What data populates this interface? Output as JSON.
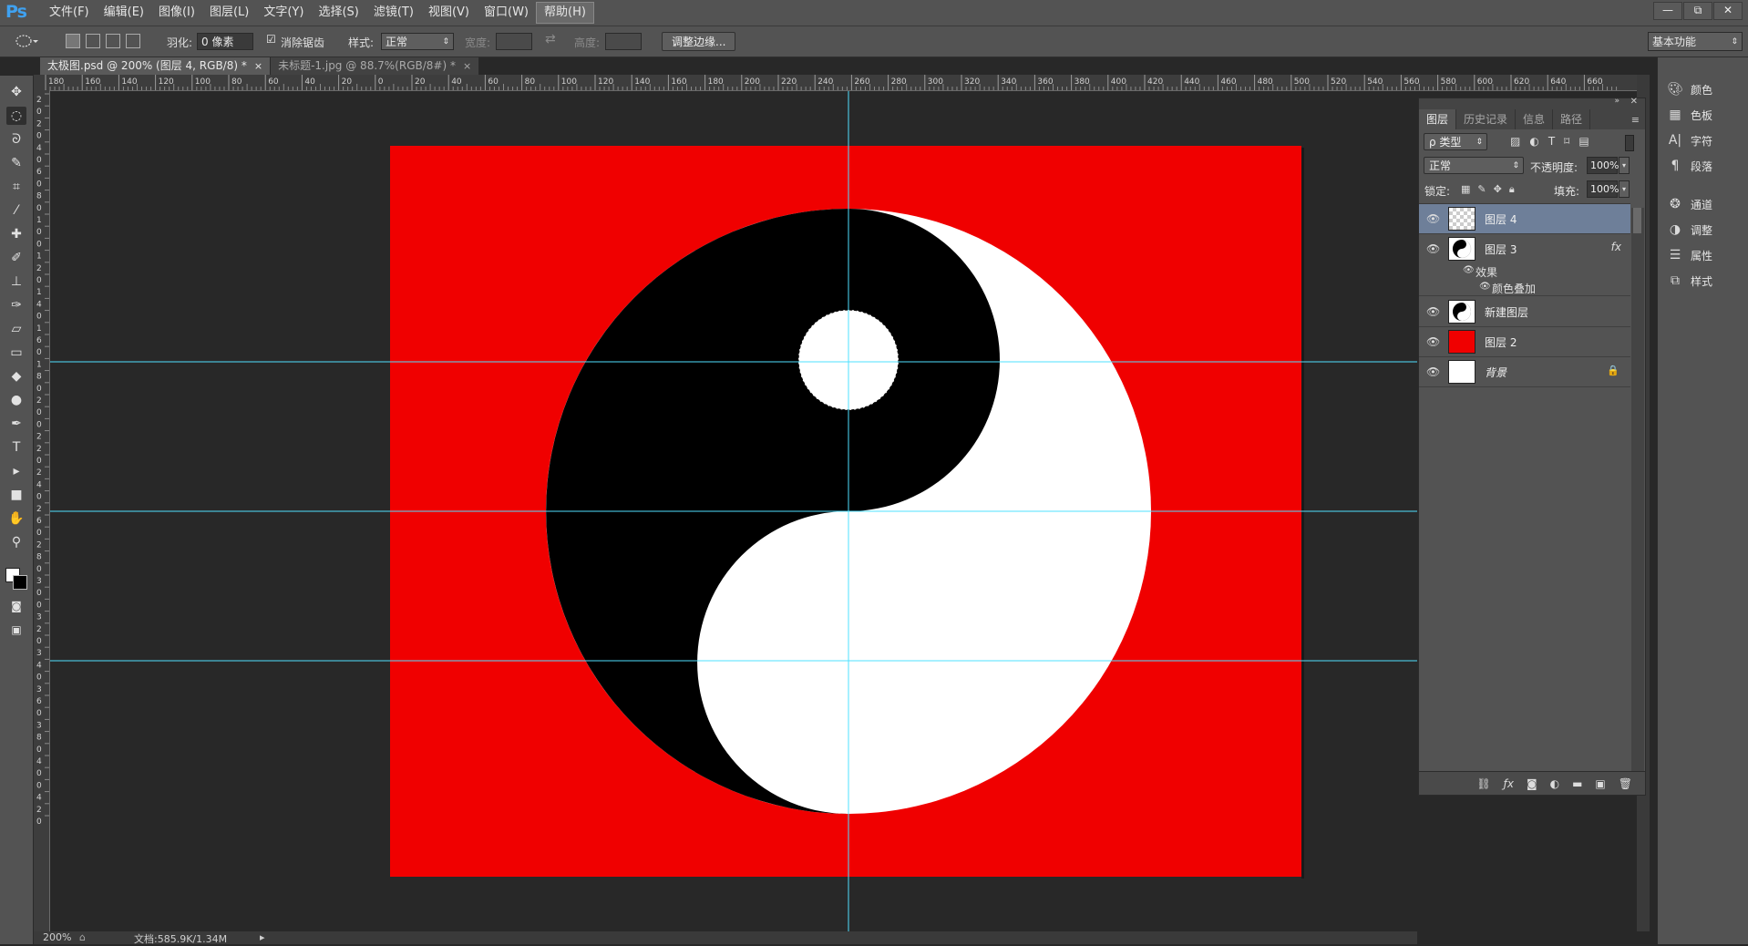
{
  "app": {
    "logo": "Ps",
    "menu": [
      "文件(F)",
      "编辑(E)",
      "图像(I)",
      "图层(L)",
      "文字(Y)",
      "选择(S)",
      "滤镜(T)",
      "视图(V)",
      "窗口(W)",
      "帮助(H)"
    ],
    "window_controls": [
      "—",
      "⧉",
      "✕"
    ]
  },
  "options": {
    "feather_label": "羽化:",
    "feather_value": "0 像素",
    "antialias_label": "消除锯齿",
    "style_label": "样式:",
    "style_value": "正常",
    "width_label": "宽度:",
    "height_label": "高度:",
    "refine_edge": "调整边缘...",
    "workspace": "基本功能"
  },
  "tabs": [
    {
      "label": "太极图.psd @ 200% (图层 4, RGB/8) *",
      "close": "×"
    },
    {
      "label": "未标题-1.jpg @ 88.7%(RGB/8#) *",
      "close": "×"
    }
  ],
  "ruler_top_labels": [
    "180",
    "160",
    "140",
    "120",
    "100",
    "80",
    "60",
    "40",
    "20",
    "0",
    "20",
    "40",
    "60",
    "80",
    "100",
    "120",
    "140",
    "160",
    "180",
    "200",
    "220",
    "240",
    "260",
    "280",
    "300",
    "320",
    "340",
    "360",
    "380",
    "400",
    "420",
    "440",
    "460",
    "480",
    "500",
    "520",
    "540",
    "560",
    "580",
    "600",
    "620",
    "640",
    "660"
  ],
  "ruler_left_labels": [
    "2",
    "0",
    "2",
    "0",
    "4",
    "0",
    "6",
    "0",
    "8",
    "0",
    "1",
    "0",
    "0",
    "1",
    "2",
    "0",
    "1",
    "4",
    "0",
    "1",
    "6",
    "0",
    "1",
    "8",
    "0",
    "2",
    "0",
    "0",
    "2",
    "2",
    "0",
    "2",
    "4",
    "0",
    "2",
    "6",
    "0",
    "2",
    "8",
    "0",
    "3",
    "0",
    "0",
    "3",
    "2",
    "0",
    "3",
    "4",
    "0",
    "3",
    "6",
    "0",
    "3",
    "8",
    "0",
    "4",
    "0",
    "0",
    "4",
    "2",
    "0"
  ],
  "status": {
    "zoom": "200%",
    "doc": "文档:585.9K/1.34M"
  },
  "layers_panel": {
    "tabs": [
      "图层",
      "历史记录",
      "信息",
      "路径"
    ],
    "filter_kind": "ρ 类型",
    "blend_mode": "正常",
    "opacity_label": "不透明度:",
    "opacity_value": "100%",
    "lock_label": "锁定:",
    "fill_label": "填充:",
    "fill_value": "100%",
    "layers": [
      {
        "name": "图层 4",
        "thumb": "transparent",
        "selected": true
      },
      {
        "name": "图层 3",
        "thumb": "taiji",
        "fx": "fx"
      },
      {
        "name": "新建图层",
        "thumb": "taiji2"
      },
      {
        "name": "图层 2",
        "thumb": "red"
      },
      {
        "name": "背景",
        "thumb": "white",
        "lock": "🔒"
      }
    ],
    "effects_label": "效果",
    "effect_item": "颜色叠加",
    "bottom_icons": [
      "link",
      "fx",
      "mask",
      "adjust",
      "folder",
      "new",
      "trash"
    ]
  },
  "dock": [
    {
      "label": "颜色",
      "icon": "palette-icon"
    },
    {
      "label": "色板",
      "icon": "swatches-icon"
    },
    {
      "label": "字符",
      "icon": "character-icon"
    },
    {
      "label": "段落",
      "icon": "paragraph-icon"
    },
    {
      "label": "通道",
      "icon": "channels-icon"
    },
    {
      "label": "调整",
      "icon": "adjustments-icon"
    },
    {
      "label": "属性",
      "icon": "properties-icon"
    },
    {
      "label": "样式",
      "icon": "styles-icon"
    }
  ],
  "colors": {
    "canvas_bg": "#f00000",
    "yin": "#000000",
    "yang": "#ffffff",
    "guide": "#4fe0ff",
    "selected_layer": "#6e7f99"
  }
}
